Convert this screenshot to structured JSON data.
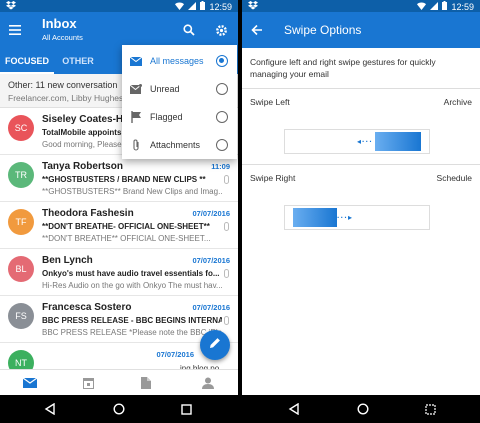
{
  "status": {
    "time": "12:59"
  },
  "inbox": {
    "title": "Inbox",
    "account": "All Accounts",
    "tabs": [
      "FOCUSED",
      "OTHER"
    ],
    "other_banner": {
      "line1": "Other: 11 new conversation",
      "line2": "Freelancer.com, Libby Hughes,"
    },
    "filter_menu": [
      {
        "label": "All messages",
        "icon": "envelope-icon",
        "selected": true
      },
      {
        "label": "Unread",
        "icon": "unread-envelope-icon",
        "selected": false
      },
      {
        "label": "Flagged",
        "icon": "flag-icon",
        "selected": false
      },
      {
        "label": "Attachments",
        "icon": "paperclip-icon",
        "selected": false
      }
    ],
    "messages": [
      {
        "initials": "SC",
        "color": "#e9545a",
        "sender": "Siseley Coates-Hars",
        "date": "",
        "subject": "TotalMobile appoints",
        "preview": "Good morning, Please"
      },
      {
        "initials": "TR",
        "color": "#5bb87a",
        "sender": "Tanya Robertson",
        "date": "11:09",
        "subject": "**GHOSTBUSTERS / BRAND NEW CLIPS **",
        "preview": "**GHOSTBUSTERS** Brand New Clips and Imag..."
      },
      {
        "initials": "TF",
        "color": "#f19a3e",
        "sender": "Theodora Fashesin",
        "date": "07/07/2016",
        "subject": "**DON'T BREATHE- OFFICIAL ONE-SHEET**",
        "preview": "**DON'T BREATHE** OFFICIAL ONE-SHEET..."
      },
      {
        "initials": "BL",
        "color": "#e46a74",
        "sender": "Ben Lynch",
        "date": "07/07/2016",
        "subject": "Onkyo's must have audio travel essentials fo...",
        "preview": "Hi-Res Audio on the go with Onkyo The must hav..."
      },
      {
        "initials": "FS",
        "color": "#8a8f96",
        "sender": "Francesca Sostero",
        "date": "07/07/2016",
        "subject": "BBC PRESS RELEASE - BBC BEGINS INTERNATI...",
        "preview": "BBC PRESS RELEASE *Please note the BBC iPla..."
      },
      {
        "initials": "NT",
        "color": "#3cb05f",
        "sender": "",
        "date": "07/07/2016",
        "subject": "",
        "preview": "ing blog po..."
      }
    ],
    "nav": [
      "mail-icon",
      "calendar-icon",
      "files-icon",
      "people-icon"
    ],
    "accent": "#1976d2"
  },
  "swipe": {
    "title": "Swipe Options",
    "description": "Configure left and right swipe gestures for quickly managing your email",
    "left": {
      "label": "Swipe Left",
      "value": "Archive"
    },
    "right": {
      "label": "Swipe Right",
      "value": "Schedule"
    }
  }
}
